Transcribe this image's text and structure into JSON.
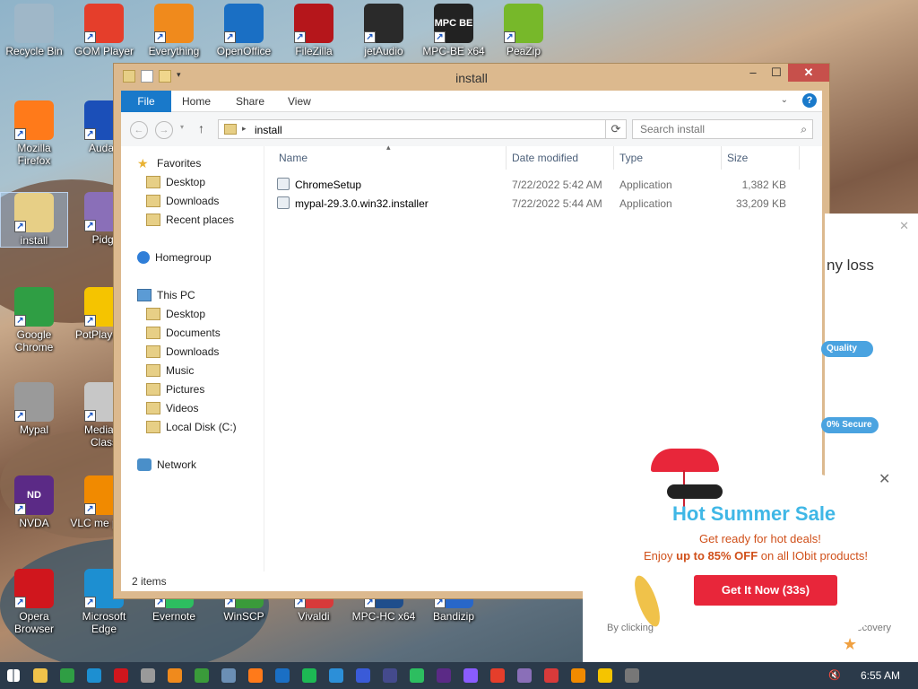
{
  "desktop": {
    "icons": [
      {
        "label": "Recycle Bin",
        "color": "#9fb7c8"
      },
      {
        "label": "GOM Player",
        "color": "#e53e2b"
      },
      {
        "label": "Everything",
        "color": "#f08a1c"
      },
      {
        "label": "OpenOffice",
        "color": "#1a6fc4"
      },
      {
        "label": "FileZilla",
        "color": "#b5161b"
      },
      {
        "label": "jetAudio",
        "color": "#2a2a2a"
      },
      {
        "label": "MPC-BE x64",
        "color": "#222222",
        "badge": "MPC BE"
      },
      {
        "label": "PeaZip",
        "color": "#77b82a"
      },
      {
        "label": "Mozilla Firefox",
        "color": "#ff7a1a"
      },
      {
        "label": "Audac",
        "color": "#1b4fb8"
      },
      {
        "label": "install",
        "color": "#e7cf86"
      },
      {
        "label": "Pidgi",
        "color": "#8a6fb8"
      },
      {
        "label": "Google Chrome",
        "color": "#2f9e44"
      },
      {
        "label": "PotPlaye bit",
        "color": "#f5c400"
      },
      {
        "label": "Mypal",
        "color": "#9a9a9a"
      },
      {
        "label": "Media P Class",
        "color": "#c7c7c7"
      },
      {
        "label": "NVDA",
        "color": "#5b2a86",
        "badge": "ND"
      },
      {
        "label": "VLC me playe",
        "color": "#f18a00"
      },
      {
        "label": "Opera Browser",
        "color": "#d0161d"
      },
      {
        "label": "Microsoft Edge",
        "color": "#1d8fd1"
      },
      {
        "label": "Evernote",
        "color": "#2dbe60"
      },
      {
        "label": "WinSCP",
        "color": "#3a9b3a"
      },
      {
        "label": "Vivaldi",
        "color": "#d83a3a"
      },
      {
        "label": "MPC-HC x64",
        "color": "#1f4e8c"
      },
      {
        "label": "Bandizip",
        "color": "#2867c9"
      }
    ]
  },
  "explorer": {
    "title": "install",
    "window_buttons": {
      "minimize": "–",
      "maximize": "☐",
      "close": "✕"
    },
    "ribbon_tabs": [
      "File",
      "Home",
      "Share",
      "View"
    ],
    "address": {
      "path": "install"
    },
    "search": {
      "placeholder": "Search install"
    },
    "navigation": {
      "favorites": "Favorites",
      "favorites_items": [
        "Desktop",
        "Downloads",
        "Recent places"
      ],
      "homegroup": "Homegroup",
      "thispc": "This PC",
      "thispc_items": [
        "Desktop",
        "Documents",
        "Downloads",
        "Music",
        "Pictures",
        "Videos",
        "Local Disk (C:)"
      ],
      "network": "Network"
    },
    "columns": {
      "name": "Name",
      "date": "Date modified",
      "type": "Type",
      "size": "Size"
    },
    "files": [
      {
        "name": "ChromeSetup",
        "date": "7/22/2022 5:42 AM",
        "type": "Application",
        "size": "1,382 KB"
      },
      {
        "name": "mypal-29.3.0.win32.installer",
        "date": "7/22/2022 5:44 AM",
        "type": "Application",
        "size": "33,209 KB"
      }
    ],
    "status": "2 items"
  },
  "ad": {
    "back_text": "ny loss",
    "pill_quality": "Quality",
    "pill_secure": "0% Secure",
    "headline": "Hot Summer Sale",
    "sub": "Get ready for hot deals!",
    "offer_prefix": "Enjoy ",
    "offer_bold": "up to 85% OFF",
    "offer_suffix": " on all IObit products!",
    "cta": "Get It Now (33s)",
    "footer_left": "By clicking",
    "footer_right": "Recovery",
    "close": "✕",
    "accent": "#e8263a",
    "headline_color": "#3fb7e6"
  },
  "taskbar": {
    "time": "6:55 AM",
    "apps": [
      "#f0c24a",
      "#2f9e44",
      "#1d8fd1",
      "#d0161d",
      "#9a9a9a",
      "#f08a1c",
      "#3a9b3a",
      "#6b8fb5",
      "#ff7a1a",
      "#1a6fc4",
      "#1db954",
      "#2c8fd8",
      "#3a5bd8",
      "#444a8c",
      "#2dbe60",
      "#5b2a86",
      "#8a5cff",
      "#e53e2b",
      "#8a6fb8",
      "#d83a3a",
      "#f18a00",
      "#f5c400",
      "#777777"
    ]
  }
}
